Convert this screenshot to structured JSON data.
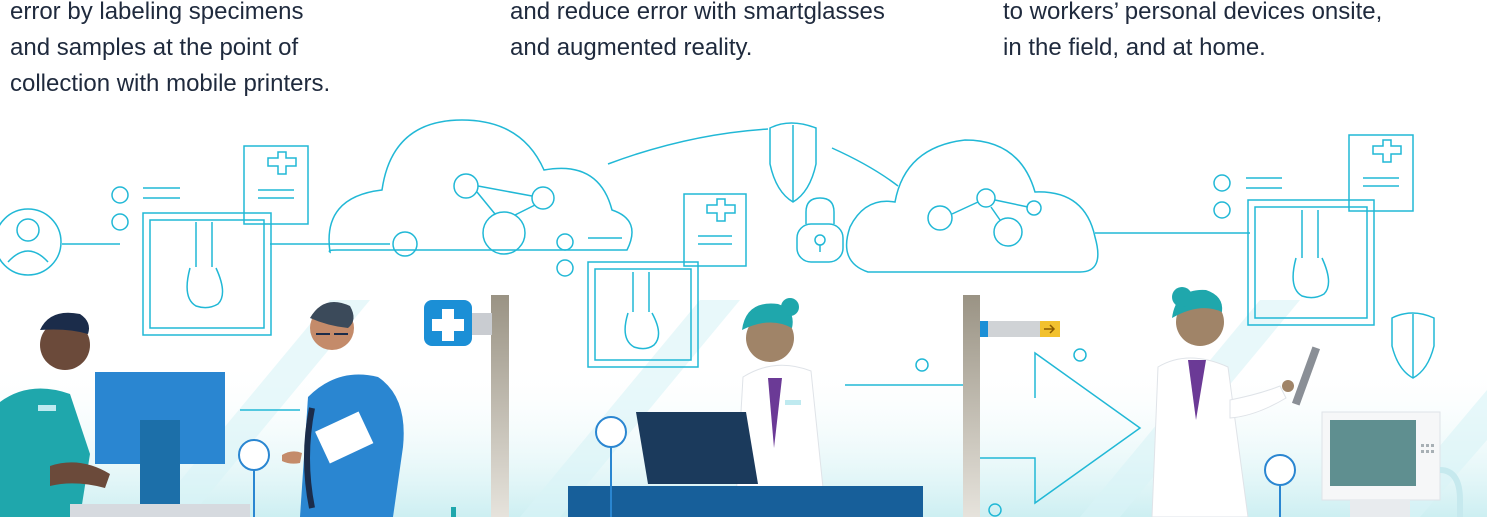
{
  "captions": {
    "left": "error by labeling specimens\nand samples at the point of\ncollection with mobile printers.",
    "middle": "and reduce error with smartglasses\nand augmented reality.",
    "right": "to workers’ personal devices onsite,\nin the field, and at home."
  },
  "colors": {
    "line": "#21b8d6",
    "navy": "#1b2c4a",
    "blue": "#2a86d1",
    "teal": "#1fa7ac",
    "purple": "#6b3a96",
    "yellow": "#f2c12e"
  },
  "icons": [
    "user-icon",
    "cloud-icon",
    "shield-icon",
    "lock-icon",
    "medical-cross-icon",
    "arrow-icon"
  ]
}
